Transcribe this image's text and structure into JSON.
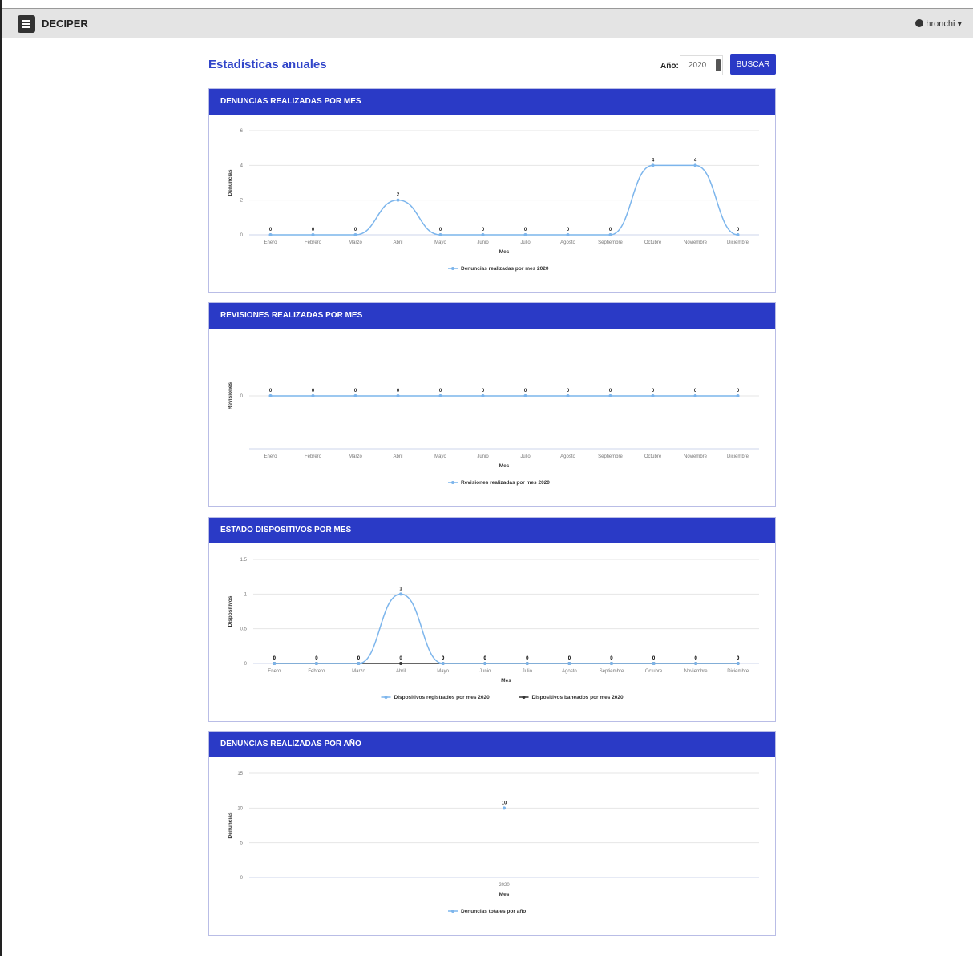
{
  "app": {
    "brand": "DECIPER",
    "user": "hronchi"
  },
  "header": {
    "title": "Estadísticas anuales",
    "year_label": "Año:",
    "year_value": "2020",
    "search_label": "BUSCAR"
  },
  "colors": {
    "primary": "#2a3ac6",
    "series_blue": "#7cb5ec",
    "series_dark": "#333333"
  },
  "icons": {
    "menu": "hamburger-menu-icon",
    "user": "user-circle-icon",
    "dropdown": "caret-down-icon"
  },
  "months": [
    "Enero",
    "Febrero",
    "Marzo",
    "Abril",
    "Mayo",
    "Junio",
    "Julio",
    "Agosto",
    "Septiembre",
    "Octubre",
    "Noviembre",
    "Diciembre"
  ],
  "cards": [
    {
      "title": "DENUNCIAS REALIZADAS POR MES"
    },
    {
      "title": "REVISIONES REALIZADAS POR MES"
    },
    {
      "title": "ESTADO DISPOSITIVOS POR MES"
    },
    {
      "title": "DENUNCIAS REALIZADAS POR AÑO"
    }
  ],
  "chart_data": [
    {
      "type": "line",
      "title": "",
      "xlabel": "Mes",
      "ylabel": "Denuncias",
      "ylim": [
        0,
        6
      ],
      "yticks": [
        "0",
        "2",
        "4",
        "6"
      ],
      "categories": [
        "Enero",
        "Febrero",
        "Marzo",
        "Abril",
        "Mayo",
        "Junio",
        "Julio",
        "Agosto",
        "Septiembre",
        "Octubre",
        "Noviembre",
        "Diciembre"
      ],
      "series": [
        {
          "name": "Denuncias realizadas por mes 2020",
          "values": [
            0,
            0,
            0,
            2,
            0,
            0,
            0,
            0,
            0,
            4,
            4,
            0
          ],
          "color": "#7cb5ec"
        }
      ],
      "legend": "bottom-center",
      "grid": true
    },
    {
      "type": "line",
      "title": "",
      "xlabel": "Mes",
      "ylabel": "Revisiones",
      "ylim": [
        0,
        0
      ],
      "yticks": [
        "0"
      ],
      "categories": [
        "Enero",
        "Febrero",
        "Marzo",
        "Abril",
        "Mayo",
        "Junio",
        "Julio",
        "Agosto",
        "Septiembre",
        "Octubre",
        "Noviembre",
        "Diciembre"
      ],
      "series": [
        {
          "name": "Revisiones realizadas por mes 2020",
          "values": [
            0,
            0,
            0,
            0,
            0,
            0,
            0,
            0,
            0,
            0,
            0,
            0
          ],
          "color": "#7cb5ec"
        }
      ],
      "legend": "bottom-center",
      "grid": true
    },
    {
      "type": "line",
      "title": "",
      "xlabel": "Mes",
      "ylabel": "Dispositivos",
      "ylim": [
        0,
        1.5
      ],
      "yticks": [
        "0",
        "0.5",
        "1",
        "1.5"
      ],
      "categories": [
        "Enero",
        "Febrero",
        "Marzo",
        "Abril",
        "Mayo",
        "Junio",
        "Julio",
        "Agosto",
        "Septiembre",
        "Octubre",
        "Noviembre",
        "Diciembre"
      ],
      "series": [
        {
          "name": "Dispositivos registrados por mes 2020",
          "values": [
            0,
            0,
            0,
            1,
            0,
            0,
            0,
            0,
            0,
            0,
            0,
            0
          ],
          "color": "#7cb5ec"
        },
        {
          "name": "Dispositivos baneados por mes 2020",
          "values": [
            0,
            0,
            0,
            0,
            0,
            0,
            0,
            0,
            0,
            0,
            0,
            0
          ],
          "color": "#333333"
        }
      ],
      "legend": "bottom-center",
      "grid": true
    },
    {
      "type": "line",
      "title": "",
      "xlabel": "Mes",
      "ylabel": "Denuncias",
      "ylim": [
        0,
        15
      ],
      "yticks": [
        "0",
        "5",
        "10",
        "15"
      ],
      "categories": [
        "2020"
      ],
      "series": [
        {
          "name": "Denuncias totales por año",
          "values": [
            10
          ],
          "color": "#7cb5ec"
        }
      ],
      "legend": "bottom-center",
      "grid": true
    }
  ]
}
